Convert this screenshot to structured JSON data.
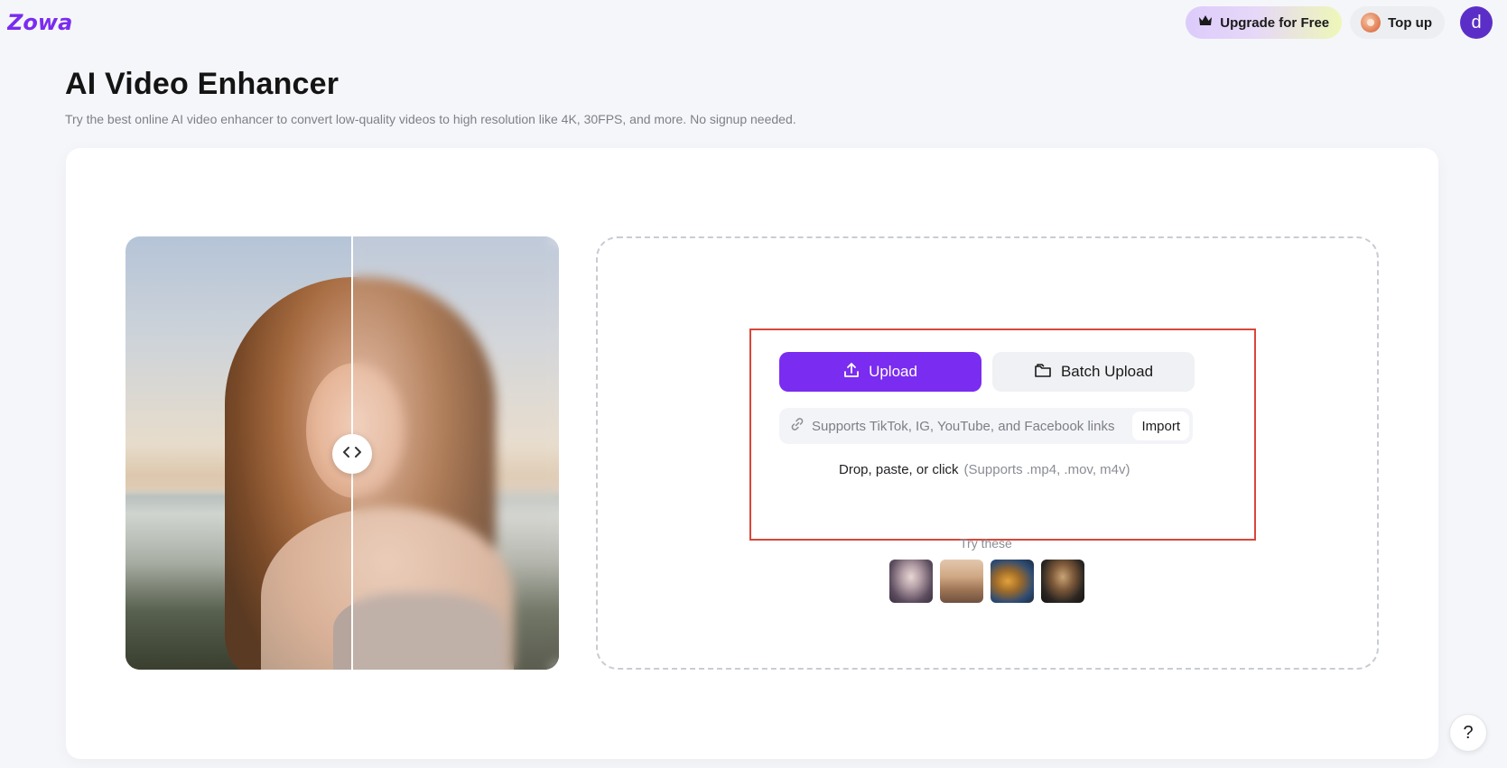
{
  "header": {
    "logo_text": "Zowa",
    "upgrade_label": "Upgrade for Free",
    "topup_label": "Top up",
    "avatar_initial": "d",
    "brand_color": "#7a2cf0"
  },
  "page": {
    "title": "AI Video Enhancer",
    "subtitle": "Try the best online AI video enhancer to convert low-quality videos to high resolution like 4K, 30FPS, and more. No signup needed."
  },
  "uploader": {
    "upload_label": "Upload",
    "batch_upload_label": "Batch Upload",
    "link_placeholder": "Supports TikTok, IG, YouTube, and Facebook links",
    "import_label": "Import",
    "drop_hint": "Drop, paste, or click",
    "formats_hint": "(Supports .mp4, .mov, m4v)",
    "try_these_label": "Try these",
    "samples": [
      "sample-portrait",
      "sample-landscape",
      "sample-autumn",
      "sample-coffee"
    ]
  },
  "help": {
    "label": "?"
  }
}
